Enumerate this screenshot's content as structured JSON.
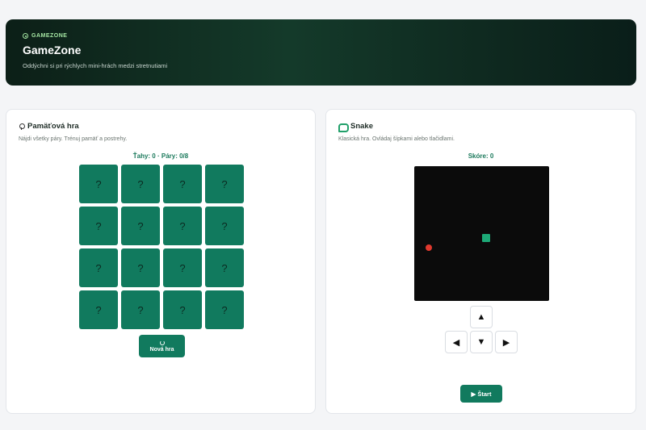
{
  "header": {
    "brand": "GAMEZONE",
    "title": "GameZone",
    "subtitle": "Oddýchni si pri rýchlych mini-hrách medzi stretnutiami"
  },
  "memory": {
    "title": "Pamäťová hra",
    "description": "Nájdi všetky páry. Trénuj pamäť a postrehy.",
    "stats": "Ťahy: 0 · Páry: 0/8",
    "tiles": [
      "?",
      "?",
      "?",
      "?",
      "?",
      "?",
      "?",
      "?",
      "?",
      "?",
      "?",
      "?",
      "?",
      "?",
      "?",
      "?"
    ],
    "new_game_label": "Nová hra"
  },
  "snake": {
    "title": "Snake",
    "description": "Klasická hra. Ovládaj šípkami alebo tlačidlami.",
    "score": "Skóre: 0",
    "controls": {
      "up": "▲",
      "left": "◀",
      "down": "▼",
      "right": "▶"
    },
    "start_label": "▶ Štart"
  },
  "colors": {
    "accent": "#117a5e",
    "snake": "#1da977",
    "food": "#e0392e",
    "board": "#0b0b0b"
  }
}
